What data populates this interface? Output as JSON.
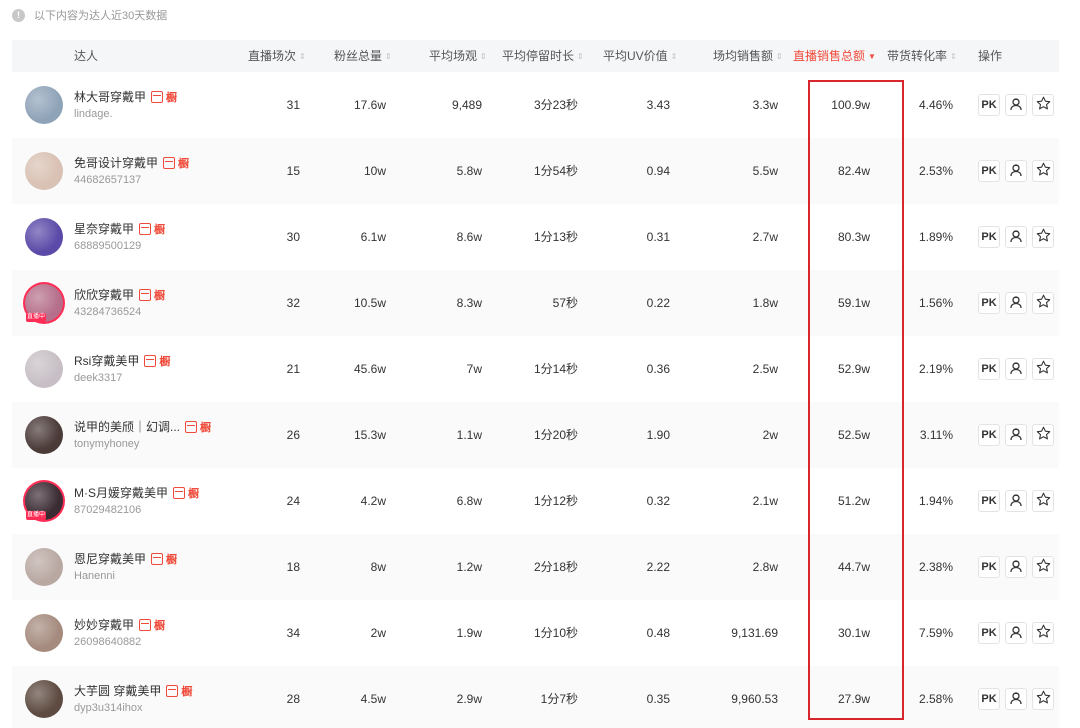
{
  "notice": "以下内容为达人近30天数据",
  "headers": {
    "influencer": "达人",
    "sessions": "直播场次",
    "fans": "粉丝总量",
    "avg_views": "平均场观",
    "avg_stay": "平均停留时长",
    "avg_uv": "平均UV价值",
    "avg_sales": "场均销售额",
    "total_sales": "直播销售总额",
    "conversion": "带货转化率",
    "actions": "操作"
  },
  "pk_label": "PK",
  "live_badge": "直播中",
  "colors": {
    "accent": "#f04b3a",
    "highlight_box": "#d9252c"
  },
  "rows": [
    {
      "name": "林大哥穿戴甲",
      "id": "lindage.",
      "sessions": "31",
      "fans": "17.6w",
      "avg_views": "9,489",
      "avg_stay": "3分23秒",
      "avg_uv": "3.43",
      "avg_sales": "3.3w",
      "total_sales": "100.9w",
      "conversion": "4.46%",
      "avatar_color": "#8fa3b8",
      "live": false
    },
    {
      "name": "免哥设计穿戴甲",
      "id": "44682657137",
      "sessions": "15",
      "fans": "10w",
      "avg_views": "5.8w",
      "avg_stay": "1分54秒",
      "avg_uv": "0.94",
      "avg_sales": "5.5w",
      "total_sales": "82.4w",
      "conversion": "2.53%",
      "avatar_color": "#d9c1b3",
      "live": false
    },
    {
      "name": "星奈穿戴甲",
      "id": "68889500129",
      "sessions": "30",
      "fans": "6.1w",
      "avg_views": "8.6w",
      "avg_stay": "1分13秒",
      "avg_uv": "0.31",
      "avg_sales": "2.7w",
      "total_sales": "80.3w",
      "conversion": "1.89%",
      "avatar_color": "#5b4aa8",
      "live": false
    },
    {
      "name": "欣欣穿戴甲",
      "id": "43284736524",
      "sessions": "32",
      "fans": "10.5w",
      "avg_views": "8.3w",
      "avg_stay": "57秒",
      "avg_uv": "0.22",
      "avg_sales": "1.8w",
      "total_sales": "59.1w",
      "conversion": "1.56%",
      "avatar_color": "#b56f8a",
      "live": true
    },
    {
      "name": "Rsi穿戴美甲",
      "id": "deek3317",
      "sessions": "21",
      "fans": "45.6w",
      "avg_views": "7w",
      "avg_stay": "1分14秒",
      "avg_uv": "0.36",
      "avg_sales": "2.5w",
      "total_sales": "52.9w",
      "conversion": "2.19%",
      "avatar_color": "#c7bfc5",
      "live": false
    },
    {
      "name": "说甲的美颀｜幻调...",
      "id": "tonymyhoney",
      "sessions": "26",
      "fans": "15.3w",
      "avg_views": "1.1w",
      "avg_stay": "1分20秒",
      "avg_uv": "1.90",
      "avg_sales": "2w",
      "total_sales": "52.5w",
      "conversion": "3.11%",
      "avatar_color": "#4a3a38",
      "live": false
    },
    {
      "name": "M·S月媛穿戴美甲",
      "id": "87029482106",
      "sessions": "24",
      "fans": "4.2w",
      "avg_views": "6.8w",
      "avg_stay": "1分12秒",
      "avg_uv": "0.32",
      "avg_sales": "2.1w",
      "total_sales": "51.2w",
      "conversion": "1.94%",
      "avatar_color": "#3b2b33",
      "live": true
    },
    {
      "name": "恩尼穿戴美甲",
      "id": "Hanenni",
      "sessions": "18",
      "fans": "8w",
      "avg_views": "1.2w",
      "avg_stay": "2分18秒",
      "avg_uv": "2.22",
      "avg_sales": "2.8w",
      "total_sales": "44.7w",
      "conversion": "2.38%",
      "avatar_color": "#b9a8a2",
      "live": false
    },
    {
      "name": "妙妙穿戴甲",
      "id": "26098640882",
      "sessions": "34",
      "fans": "2w",
      "avg_views": "1.9w",
      "avg_stay": "1分10秒",
      "avg_uv": "0.48",
      "avg_sales": "9,131.69",
      "total_sales": "30.1w",
      "conversion": "7.59%",
      "avatar_color": "#a58b7e",
      "live": false
    },
    {
      "name": "大芋圆 穿戴美甲",
      "id": "dyp3u314ihox",
      "sessions": "28",
      "fans": "4.5w",
      "avg_views": "2.9w",
      "avg_stay": "1分7秒",
      "avg_uv": "0.35",
      "avg_sales": "9,960.53",
      "total_sales": "27.9w",
      "conversion": "2.58%",
      "avatar_color": "#5d4a40",
      "live": false
    }
  ]
}
